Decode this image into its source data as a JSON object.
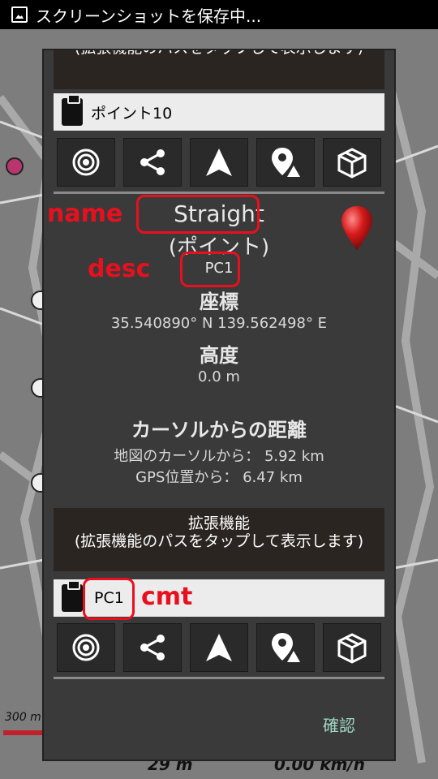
{
  "status_bar": {
    "text": "スクリーンショットを保存中..."
  },
  "map": {
    "scale": "300 m",
    "bottom_left_value": "29 m",
    "bottom_right_value": "0.00 km/h"
  },
  "dialog": {
    "top_header": "(拡張機能のパスをタップして表示します)",
    "point_name": "ポイント10",
    "waypoint": {
      "name": "Straight",
      "category": "(ポイント)",
      "desc": "PC1",
      "coords_title": "座標",
      "coords": "35.540890° N 139.562498° E",
      "altitude_title": "高度",
      "altitude": "0.0 m",
      "distance_title": "カーソルからの距離",
      "from_cursor": "地図のカーソルから： 5.92 km",
      "from_gps": "GPS位置から： 6.47 km"
    },
    "ext_header_title": "拡張機能",
    "ext_header_sub": "(拡張機能のパスをタップして表示します)",
    "cmt_value": "PC1",
    "confirm": "確認"
  },
  "annotations": {
    "name": "name",
    "desc": "desc",
    "cmt": "cmt"
  },
  "icons": [
    "target-icon",
    "share-icon",
    "navigate-icon",
    "map-pin-icon",
    "package-icon"
  ],
  "colors": {
    "annotation": "#e8101e",
    "confirm": "#9fd6c4",
    "header_bg": "#2a2521"
  }
}
